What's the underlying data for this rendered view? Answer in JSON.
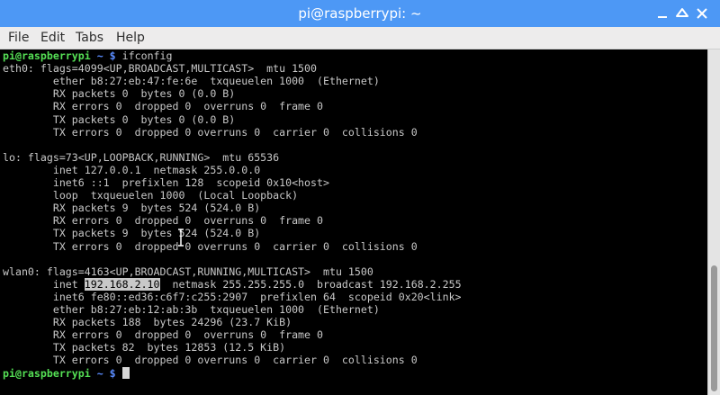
{
  "window": {
    "title": "pi@raspberrypi: ~"
  },
  "icons": {
    "minimize": "minimize-icon",
    "maximize": "maximize-icon",
    "close": "close-icon"
  },
  "menu": {
    "file": "File",
    "edit": "Edit",
    "tabs": "Tabs",
    "help": "Help"
  },
  "colors": {
    "titlebar": "#4d98f5",
    "prompt_user": "#55e055",
    "prompt_path": "#5a8cff",
    "terminal_text": "#c8c8c8",
    "terminal_bg": "#000000"
  },
  "prompt": {
    "user": "pi@raspberrypi",
    "path": "~ $"
  },
  "terminal": {
    "command": "ifconfig",
    "lines": [
      "eth0: flags=4099<UP,BROADCAST,MULTICAST>  mtu 1500",
      "        ether b8:27:eb:47:fe:6e  txqueuelen 1000  (Ethernet)",
      "        RX packets 0  bytes 0 (0.0 B)",
      "        RX errors 0  dropped 0  overruns 0  frame 0",
      "        TX packets 0  bytes 0 (0.0 B)",
      "        TX errors 0  dropped 0 overruns 0  carrier 0  collisions 0",
      "",
      "lo: flags=73<UP,LOOPBACK,RUNNING>  mtu 65536",
      "        inet 127.0.0.1  netmask 255.0.0.0",
      "        inet6 ::1  prefixlen 128  scopeid 0x10<host>",
      "        loop  txqueuelen 1000  (Local Loopback)",
      "        RX packets 9  bytes 524 (524.0 B)",
      "        RX errors 0  dropped 0  overruns 0  frame 0",
      "        TX packets 9  bytes 524 (524.0 B)",
      "        TX errors 0  dropped 0 overruns 0  carrier 0  collisions 0",
      "",
      "wlan0: flags=4163<UP,BROADCAST,RUNNING,MULTICAST>  mtu 1500"
    ],
    "inet_line": {
      "prefix": "        inet ",
      "selected": "192.168.2.10",
      "suffix": "  netmask 255.255.255.0  broadcast 192.168.2.255"
    },
    "lines_after": [
      "        inet6 fe80::ed36:c6f7:c255:2907  prefixlen 64  scopeid 0x20<link>",
      "        ether b8:27:eb:12:ab:3b  txqueuelen 1000  (Ethernet)",
      "        RX packets 188  bytes 24296 (23.7 KiB)",
      "        RX errors 0  dropped 0  overruns 0  frame 0",
      "        TX packets 82  bytes 12853 (12.5 KiB)",
      "        TX errors 0  dropped 0 overruns 0  carrier 0  collisions 0"
    ]
  }
}
